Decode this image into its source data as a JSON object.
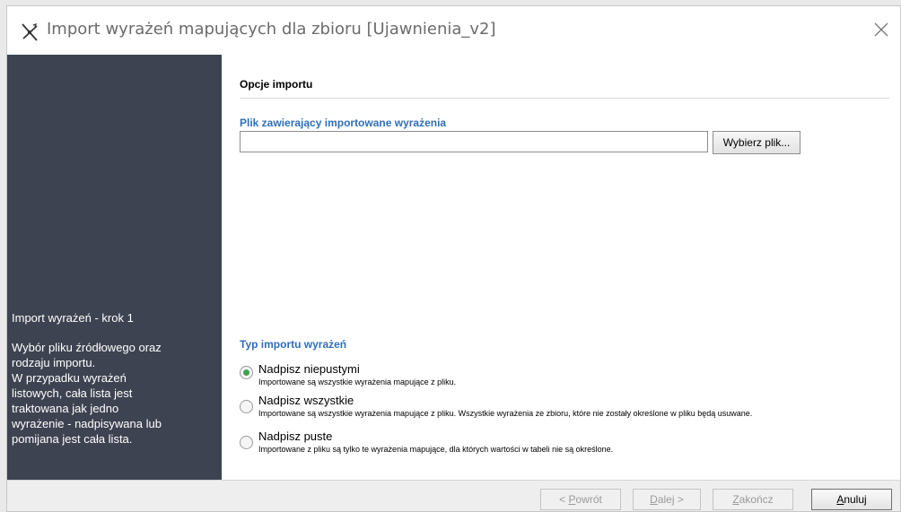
{
  "window": {
    "title": "Import wyrażeń mapujących dla zbioru [Ujawnienia_v2]"
  },
  "sidebar": {
    "step_title": "Import wyrażeń - krok 1",
    "description_lines": [
      "Wybór pliku źródłowego oraz",
      "rodzaju importu.",
      "W przypadku wyrażeń",
      "listowych, cała lista jest",
      "traktowana jak jedno",
      "wyrażenie - nadpisywana lub",
      "pomijana jest cała lista."
    ]
  },
  "main": {
    "section_title": "Opcje importu",
    "file_label": "Plik zawierający importowane wyrażenia",
    "file_value": "",
    "browse_button": "Wybierz plik...",
    "import_type_label": "Typ importu wyrażeń",
    "options": [
      {
        "label": "Nadpisz niepustymi",
        "description": "Importowane są wszystkie wyrażenia mapujące z pliku.",
        "checked": true
      },
      {
        "label": "Nadpisz wszystkie",
        "description": "Importowane są wszystkie wyrażenia mapujące z pliku. Wszystkie wyrażenia ze zbioru, które nie zostały określone w pliku będą usuwane.",
        "checked": false
      },
      {
        "label": "Nadpisz puste",
        "description": "Importowane z pliku są tylko te wyrażenia mapujące, dla których wartości w tabeli nie są określone.",
        "checked": false
      }
    ]
  },
  "footer": {
    "back": {
      "prefix": "< ",
      "key": "P",
      "rest": "owrót",
      "enabled": false
    },
    "next": {
      "key": "D",
      "rest": "alej >",
      "enabled": false
    },
    "finish": {
      "key": "Z",
      "rest": "akończ",
      "enabled": false
    },
    "cancel": {
      "key": "A",
      "rest": "nuluj",
      "enabled": true
    }
  },
  "icons": {
    "app": "wizard-icon",
    "close": "close-icon"
  },
  "colors": {
    "sidebar_bg": "#3d4350",
    "label_blue": "#2f6fb6",
    "radio_selected": "#3fa34d"
  }
}
